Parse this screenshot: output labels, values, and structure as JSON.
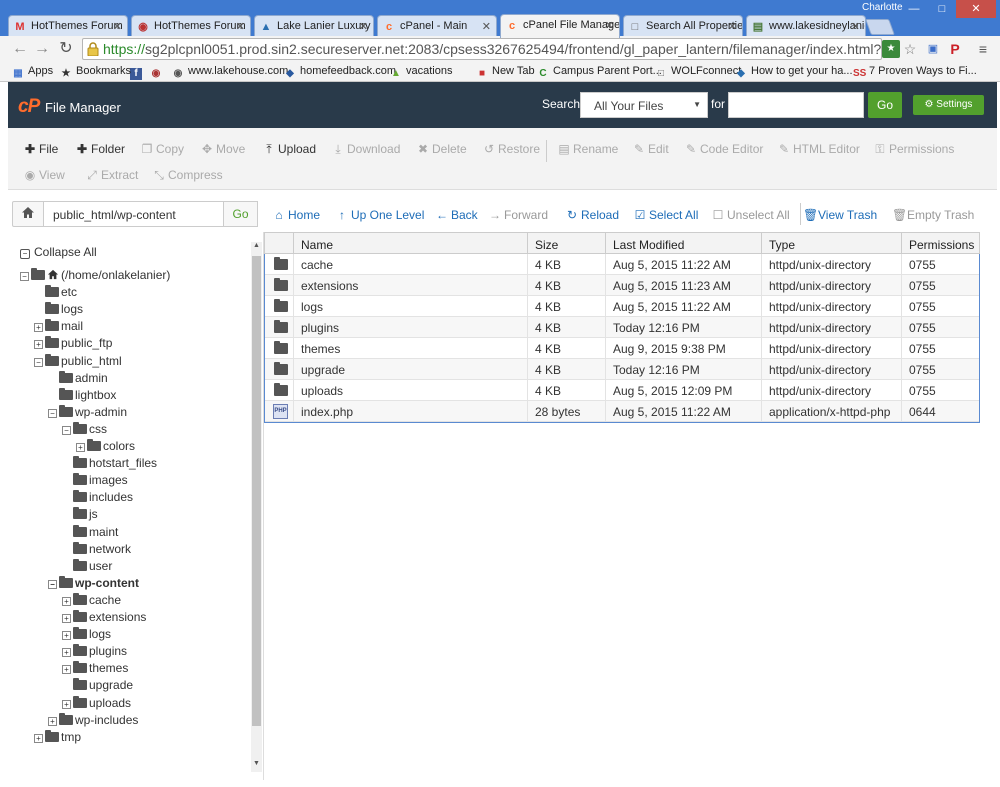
{
  "browser": {
    "tabs": [
      {
        "label": "HotThemes Forum",
        "icon": "gmail-icon"
      },
      {
        "label": "HotThemes Forum",
        "icon": "hotthemes-icon"
      },
      {
        "label": "Lake Lanier Luxury",
        "icon": "triangle-icon"
      },
      {
        "label": "cPanel - Main",
        "icon": "cpanel-icon"
      },
      {
        "label": "cPanel File Manage",
        "icon": "cpanel-icon"
      },
      {
        "label": "Search All Propertie",
        "icon": "page-icon"
      },
      {
        "label": "www.lakesidneylanie",
        "icon": "site-icon"
      }
    ],
    "profile": "Charlotte",
    "url_scheme": "https://",
    "url_rest": "sg2plcpnl0051.prod.sin2.secureserver.net:2083/cpsess3267625494/frontend/gl_paper_lantern/filemanager/index.html?dirselect=webroot",
    "bookmarks": [
      "Apps",
      "Bookmarks",
      "www.lakehouse.com",
      "homefeedback.com",
      "vacations",
      "New Tab",
      "Campus Parent Port...",
      "WOLFconnect",
      "How to get your ha...",
      "7 Proven Ways to Fi..."
    ]
  },
  "header": {
    "logo": "cP",
    "title": "File Manager",
    "search_label": "Search",
    "search_scope": "All Your Files",
    "for_label": "for",
    "search_value": "",
    "go_label": "Go",
    "settings_label": "Settings"
  },
  "toolbar": {
    "row1": [
      {
        "label": "File",
        "icon": "plus-icon",
        "enabled": true
      },
      {
        "label": "Folder",
        "icon": "plus-icon",
        "enabled": true
      },
      {
        "label": "Copy",
        "icon": "copy-icon",
        "enabled": false
      },
      {
        "label": "Move",
        "icon": "move-icon",
        "enabled": false
      },
      {
        "label": "Upload",
        "icon": "upload-icon",
        "enabled": true
      },
      {
        "label": "Download",
        "icon": "download-icon",
        "enabled": false
      },
      {
        "label": "Delete",
        "icon": "delete-icon",
        "enabled": false
      },
      {
        "label": "Restore",
        "icon": "restore-icon",
        "enabled": false
      },
      {
        "label": "Rename",
        "icon": "rename-icon",
        "enabled": false
      },
      {
        "label": "Edit",
        "icon": "pencil-icon",
        "enabled": false
      },
      {
        "label": "Code Editor",
        "icon": "code-editor-icon",
        "enabled": false
      },
      {
        "label": "HTML Editor",
        "icon": "html-editor-icon",
        "enabled": false
      },
      {
        "label": "Permissions",
        "icon": "key-icon",
        "enabled": false
      }
    ],
    "row2": [
      {
        "label": "View",
        "icon": "eye-icon",
        "enabled": false
      },
      {
        "label": "Extract",
        "icon": "extract-icon",
        "enabled": false
      },
      {
        "label": "Compress",
        "icon": "compress-icon",
        "enabled": false
      }
    ]
  },
  "pathbar": {
    "path": "public_html/wp-content",
    "go_label": "Go",
    "nav": [
      {
        "label": "Home",
        "icon": "home-icon",
        "enabled": true
      },
      {
        "label": "Up One Level",
        "icon": "up-arrow-icon",
        "enabled": true
      },
      {
        "label": "Back",
        "icon": "left-arrow-icon",
        "enabled": true
      },
      {
        "label": "Forward",
        "icon": "right-arrow-icon",
        "enabled": false
      },
      {
        "label": "Reload",
        "icon": "reload-icon",
        "enabled": true
      },
      {
        "label": "Select All",
        "icon": "checkbox-checked-icon",
        "enabled": true
      },
      {
        "label": "Unselect All",
        "icon": "checkbox-empty-icon",
        "enabled": false
      },
      {
        "label": "View Trash",
        "icon": "trash-icon",
        "enabled": true
      },
      {
        "label": "Empty Trash",
        "icon": "trash-icon",
        "enabled": false
      }
    ]
  },
  "tree": {
    "collapse_label": "Collapse All",
    "nodes": [
      {
        "label": "(/home/onlakelanier)",
        "depth": 0,
        "state": "open",
        "home": true
      },
      {
        "label": "etc",
        "depth": 1,
        "state": "none"
      },
      {
        "label": "logs",
        "depth": 1,
        "state": "none"
      },
      {
        "label": "mail",
        "depth": 1,
        "state": "closed"
      },
      {
        "label": "public_ftp",
        "depth": 1,
        "state": "closed"
      },
      {
        "label": "public_html",
        "depth": 1,
        "state": "open"
      },
      {
        "label": "admin",
        "depth": 2,
        "state": "none"
      },
      {
        "label": "lightbox",
        "depth": 2,
        "state": "none"
      },
      {
        "label": "wp-admin",
        "depth": 2,
        "state": "open"
      },
      {
        "label": "css",
        "depth": 3,
        "state": "open"
      },
      {
        "label": "colors",
        "depth": 4,
        "state": "closed"
      },
      {
        "label": "hotstart_files",
        "depth": 3,
        "state": "none"
      },
      {
        "label": "images",
        "depth": 3,
        "state": "none"
      },
      {
        "label": "includes",
        "depth": 3,
        "state": "none"
      },
      {
        "label": "js",
        "depth": 3,
        "state": "none"
      },
      {
        "label": "maint",
        "depth": 3,
        "state": "none"
      },
      {
        "label": "network",
        "depth": 3,
        "state": "none"
      },
      {
        "label": "user",
        "depth": 3,
        "state": "none"
      },
      {
        "label": "wp-content",
        "depth": 2,
        "state": "open",
        "bold": true
      },
      {
        "label": "cache",
        "depth": 3,
        "state": "closed"
      },
      {
        "label": "extensions",
        "depth": 3,
        "state": "closed"
      },
      {
        "label": "logs",
        "depth": 3,
        "state": "closed"
      },
      {
        "label": "plugins",
        "depth": 3,
        "state": "closed"
      },
      {
        "label": "themes",
        "depth": 3,
        "state": "closed"
      },
      {
        "label": "upgrade",
        "depth": 3,
        "state": "none"
      },
      {
        "label": "uploads",
        "depth": 3,
        "state": "closed"
      },
      {
        "label": "wp-includes",
        "depth": 2,
        "state": "closed"
      },
      {
        "label": "tmp",
        "depth": 1,
        "state": "closed"
      }
    ]
  },
  "table": {
    "columns": [
      "Name",
      "Size",
      "Last Modified",
      "Type",
      "Permissions"
    ],
    "rows": [
      {
        "kind": "folder",
        "name": "cache",
        "size": "4 KB",
        "modified": "Aug 5, 2015 11:22 AM",
        "type": "httpd/unix-directory",
        "perms": "0755"
      },
      {
        "kind": "folder",
        "name": "extensions",
        "size": "4 KB",
        "modified": "Aug 5, 2015 11:23 AM",
        "type": "httpd/unix-directory",
        "perms": "0755"
      },
      {
        "kind": "folder",
        "name": "logs",
        "size": "4 KB",
        "modified": "Aug 5, 2015 11:22 AM",
        "type": "httpd/unix-directory",
        "perms": "0755"
      },
      {
        "kind": "folder",
        "name": "plugins",
        "size": "4 KB",
        "modified": "Today 12:16 PM",
        "type": "httpd/unix-directory",
        "perms": "0755"
      },
      {
        "kind": "folder",
        "name": "themes",
        "size": "4 KB",
        "modified": "Aug 9, 2015 9:38 PM",
        "type": "httpd/unix-directory",
        "perms": "0755"
      },
      {
        "kind": "folder",
        "name": "upgrade",
        "size": "4 KB",
        "modified": "Today 12:16 PM",
        "type": "httpd/unix-directory",
        "perms": "0755"
      },
      {
        "kind": "folder",
        "name": "uploads",
        "size": "4 KB",
        "modified": "Aug 5, 2015 12:09 PM",
        "type": "httpd/unix-directory",
        "perms": "0755"
      },
      {
        "kind": "php",
        "name": "index.php",
        "size": "28 bytes",
        "modified": "Aug 5, 2015 11:22 AM",
        "type": "application/x-httpd-php",
        "perms": "0644"
      }
    ]
  },
  "colors": {
    "header_bg": "#293a4a",
    "accent_green": "#52a02d",
    "link_blue": "#1d6cb7",
    "cpanel_orange": "#ff6c2c",
    "selection_border": "#5a8ad1"
  }
}
